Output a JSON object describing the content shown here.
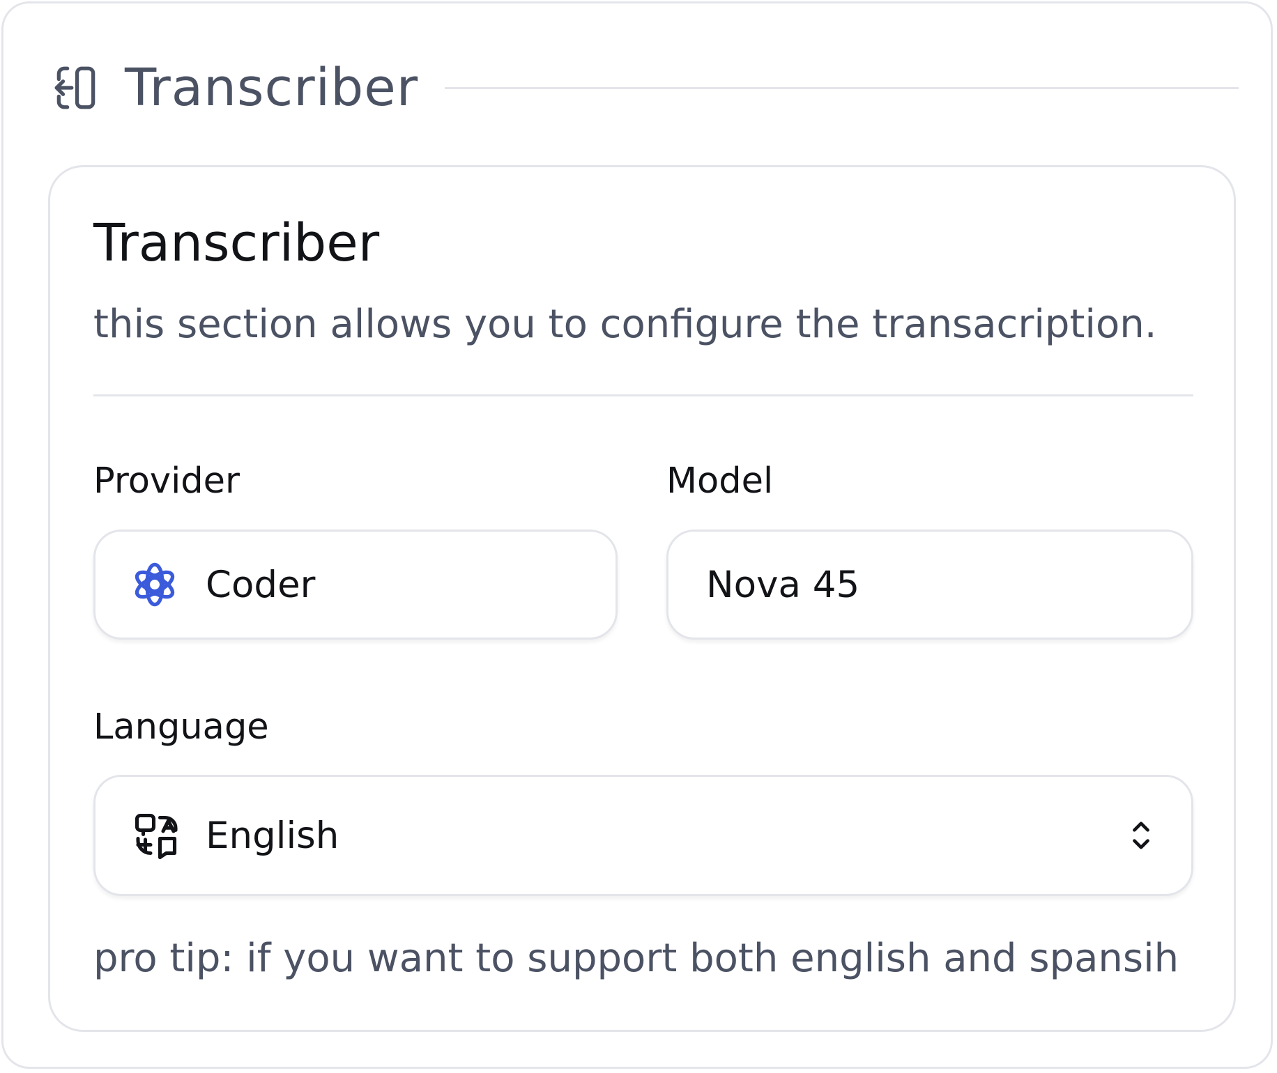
{
  "section": {
    "title": "Transcriber",
    "icon": "log-in-icon"
  },
  "card": {
    "title": "Transcriber",
    "description": "this section allows you to configure the transacription."
  },
  "provider": {
    "label": "Provider",
    "value": "Coder",
    "icon": "provider-logo-icon",
    "icon_color": "#3b5bdb"
  },
  "model": {
    "label": "Model",
    "value": "Nova 45"
  },
  "language": {
    "label": "Language",
    "value": "English",
    "icon": "translate-icon",
    "control_icon": "chevron-up-down-icon"
  },
  "tip": "pro tip: if you want to support both english and spansih",
  "colors": {
    "border": "#e3e5ea",
    "text_primary": "#111317",
    "text_secondary": "#4b5263",
    "accent": "#3b5bdb"
  }
}
